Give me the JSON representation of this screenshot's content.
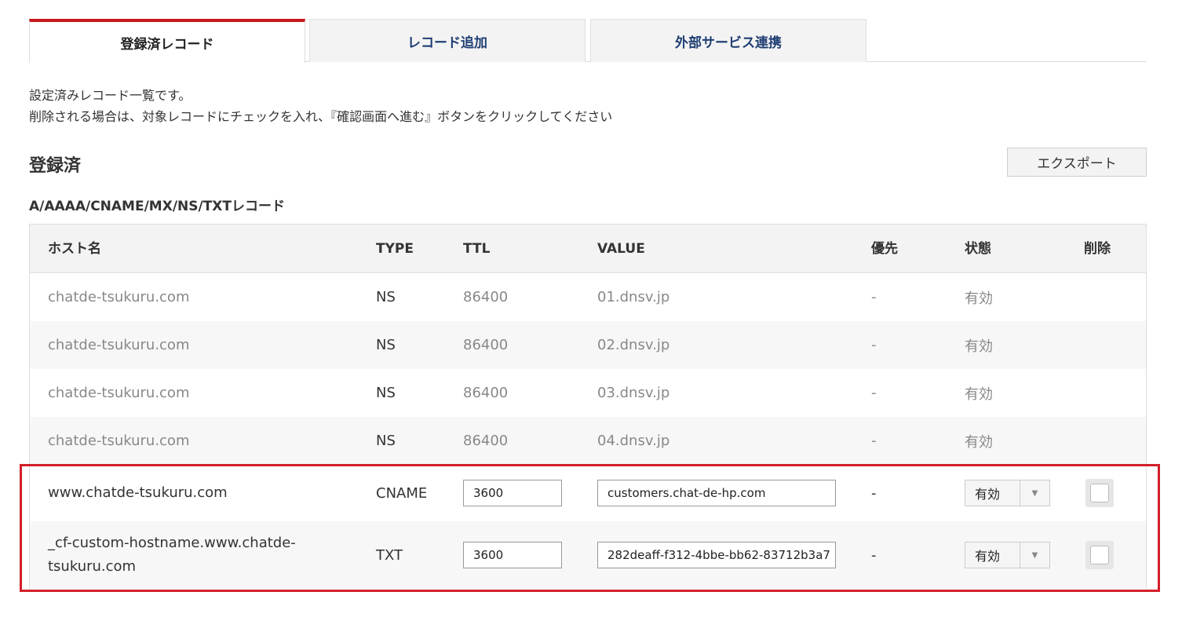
{
  "tabs": [
    {
      "label": "登録済レコード",
      "active": true
    },
    {
      "label": "レコード追加",
      "active": false
    },
    {
      "label": "外部サービス連携",
      "active": false
    }
  ],
  "description": {
    "line1": "設定済みレコード一覧です。",
    "line2": "削除される場合は、対象レコードにチェックを入れ、『確認画面へ進む』ボタンをクリックしてください"
  },
  "section_title": "登録済",
  "export_label": "エクスポート",
  "sub_title": "A/AAAA/CNAME/MX/NS/TXTレコード",
  "table": {
    "headers": {
      "host": "ホスト名",
      "type": "TYPE",
      "ttl": "TTL",
      "value": "VALUE",
      "priority": "優先",
      "status": "状態",
      "delete": "削除"
    },
    "rows": [
      {
        "host": "chatde-tsukuru.com",
        "type": "NS",
        "ttl": "86400",
        "value": "01.dnsv.jp",
        "priority": "-",
        "status": "有効"
      },
      {
        "host": "chatde-tsukuru.com",
        "type": "NS",
        "ttl": "86400",
        "value": "02.dnsv.jp",
        "priority": "-",
        "status": "有効"
      },
      {
        "host": "chatde-tsukuru.com",
        "type": "NS",
        "ttl": "86400",
        "value": "03.dnsv.jp",
        "priority": "-",
        "status": "有効"
      },
      {
        "host": "chatde-tsukuru.com",
        "type": "NS",
        "ttl": "86400",
        "value": "04.dnsv.jp",
        "priority": "-",
        "status": "有効"
      },
      {
        "host": "www.chatde-tsukuru.com",
        "type": "CNAME",
        "ttl": "3600",
        "value": "customers.chat-de-hp.com",
        "priority": "-",
        "status": "有効"
      },
      {
        "host": "_cf-custom-hostname.www.chatde-tsukuru.com",
        "host_line1": "_cf-custom-hostname.www.chatde-",
        "host_line2": "tsukuru.com",
        "type": "TXT",
        "ttl": "3600",
        "value": "282deaff-f312-4bbe-bb62-83712b3a7",
        "priority": "-",
        "status": "有効"
      }
    ]
  },
  "colors": {
    "accent": "#c8161d",
    "highlight_border": "#d4202a",
    "tab_text": "#1f3f73"
  }
}
